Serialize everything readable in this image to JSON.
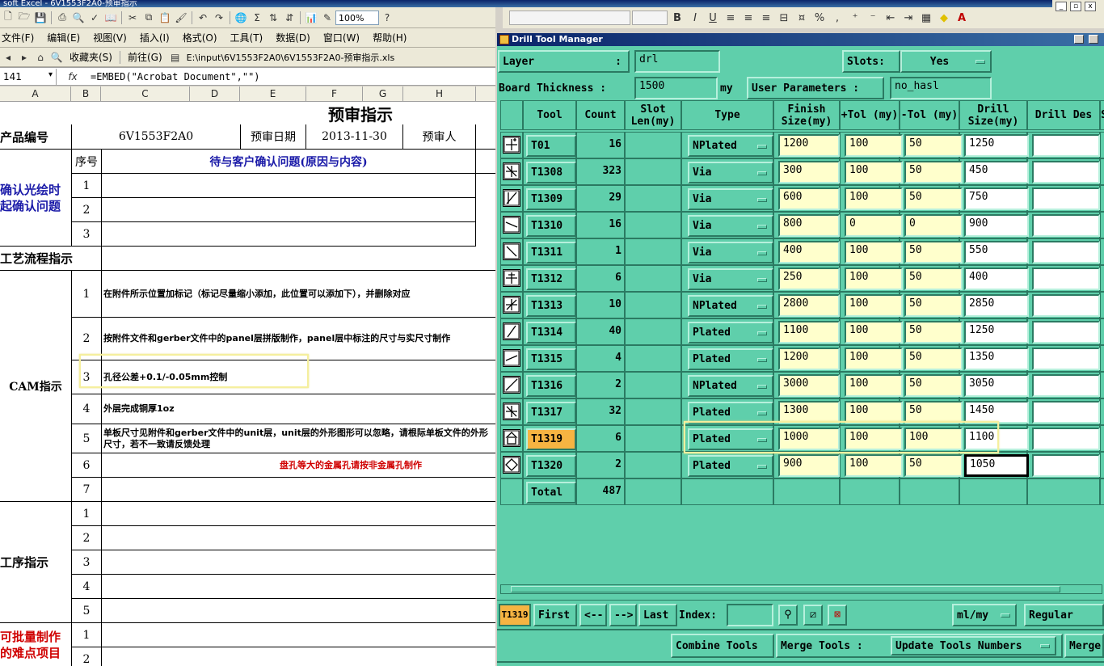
{
  "window": {
    "title": "soft Excel - 6V1553F2A0-预审指示"
  },
  "toolbar": {
    "zoom": "100%",
    "help_icon": "help-icon"
  },
  "menu": {
    "items": [
      "文件(F)",
      "编辑(E)",
      "视图(V)",
      "插入(I)",
      "格式(O)",
      "工具(T)",
      "数据(D)",
      "窗口(W)",
      "帮助(H)"
    ]
  },
  "webbar": {
    "favorites": "收藏夹(S)",
    "goto": "前往(G)",
    "path": "E:\\input\\6V1553F2A0\\6V1553F2A0-预审指示.xls"
  },
  "formula": {
    "name_box": "141",
    "fx": "fx",
    "text": "=EMBED(\"Acrobat Document\",\"\")"
  },
  "columns": [
    "A",
    "B",
    "C",
    "D",
    "E",
    "F",
    "G",
    "H"
  ],
  "sheet": {
    "title": "预审指示",
    "product_label": "产品编号",
    "product_value": "6V1553F2A0",
    "date_label": "预审日期",
    "date_value": "2013-11-30",
    "reviewer_label": "预审人",
    "seq_label": "序号",
    "question_header": "待与客户确认问题(原因与内容)",
    "confirm_section": "确认光绘时起确认问题",
    "confirm_rows": [
      "1",
      "2",
      "3"
    ],
    "process_label": "工艺流程指示",
    "cam_label": "CAM指示",
    "cam_rows": [
      {
        "n": "1",
        "text": "在附件所示位置加标记（标记尽量缩小添加，此位置可以添加下），并删除对应"
      },
      {
        "n": "2",
        "text": "按附件文件和gerber文件中的panel层拼版制作，panel层中标注的尺寸与实尺寸制作"
      },
      {
        "n": "3",
        "text": "孔径公差+0.1/-0.05mm控制"
      },
      {
        "n": "4",
        "text": "外层完成铜厚1oz"
      },
      {
        "n": "5",
        "text": "单板尺寸见附件和gerber文件中的unit层，unit层的外形图形可以忽略，请根际单板文件的外形尺寸，若不一致请反馈处理"
      },
      {
        "n": "6",
        "text": "盘孔等大的金属孔请按非金属孔制作"
      },
      {
        "n": "7",
        "text": ""
      }
    ],
    "proc_label": "工序指示",
    "proc_rows": [
      "1",
      "2",
      "3",
      "4",
      "5"
    ],
    "batch_label": "可批量制作的难点项目",
    "batch_rows": [
      "1",
      "2"
    ]
  },
  "dtm": {
    "title": "Drill Tool Manager",
    "layer_label": "Layer",
    "layer_colon": ":",
    "layer_value": "drl",
    "slots_label": "Slots:",
    "slots_value": "Yes",
    "board_label": "Board Thickness :",
    "board_value": "1500",
    "board_unit": "my",
    "user_params_label": "User Parameters :",
    "user_params_value": "no_hasl",
    "headers": [
      "Tool",
      "Count",
      "Slot Len(my)",
      "Type",
      "Finish Size(my)",
      "+Tol (my)",
      "-Tol (my)",
      "Drill Size(my)",
      "Drill Des",
      "S"
    ],
    "rows": [
      {
        "tool": "T01",
        "count": "16",
        "type": "NPlated",
        "finish": "1200",
        "ptol": "100",
        "ntol": "50",
        "drill": "1250"
      },
      {
        "tool": "T1308",
        "count": "323",
        "type": "Via",
        "finish": "300",
        "ptol": "100",
        "ntol": "50",
        "drill": "450"
      },
      {
        "tool": "T1309",
        "count": "29",
        "type": "Via",
        "finish": "600",
        "ptol": "100",
        "ntol": "50",
        "drill": "750"
      },
      {
        "tool": "T1310",
        "count": "16",
        "type": "Via",
        "finish": "800",
        "ptol": "0",
        "ntol": "0",
        "drill": "900"
      },
      {
        "tool": "T1311",
        "count": "1",
        "type": "Via",
        "finish": "400",
        "ptol": "100",
        "ntol": "50",
        "drill": "550"
      },
      {
        "tool": "T1312",
        "count": "6",
        "type": "Via",
        "finish": "250",
        "ptol": "100",
        "ntol": "50",
        "drill": "400"
      },
      {
        "tool": "T1313",
        "count": "10",
        "type": "NPlated",
        "finish": "2800",
        "ptol": "100",
        "ntol": "50",
        "drill": "2850"
      },
      {
        "tool": "T1314",
        "count": "40",
        "type": "Plated",
        "finish": "1100",
        "ptol": "100",
        "ntol": "50",
        "drill": "1250"
      },
      {
        "tool": "T1315",
        "count": "4",
        "type": "Plated",
        "finish": "1200",
        "ptol": "100",
        "ntol": "50",
        "drill": "1350"
      },
      {
        "tool": "T1316",
        "count": "2",
        "type": "NPlated",
        "finish": "3000",
        "ptol": "100",
        "ntol": "50",
        "drill": "3050"
      },
      {
        "tool": "T1317",
        "count": "32",
        "type": "Plated",
        "finish": "1300",
        "ptol": "100",
        "ntol": "50",
        "drill": "1450"
      },
      {
        "tool": "T1319",
        "count": "6",
        "type": "Plated",
        "finish": "1000",
        "ptol": "100",
        "ntol": "100",
        "drill": "1100",
        "selected": true
      },
      {
        "tool": "T1320",
        "count": "2",
        "type": "Plated",
        "finish": "900",
        "ptol": "100",
        "ntol": "50",
        "drill": "1050"
      }
    ],
    "total_label": "Total",
    "total_value": "487",
    "nav": {
      "current": "T1319",
      "first": "First",
      "prev": "<--",
      "next": "-->",
      "last": "Last",
      "index_label": "Index:",
      "units": "ml/my",
      "mode": "Regular"
    },
    "bottom": {
      "combine": "Combine Tools",
      "merge_label": "Merge Tools :",
      "update": "Update Tools Numbers",
      "merge2": "Merge"
    }
  }
}
